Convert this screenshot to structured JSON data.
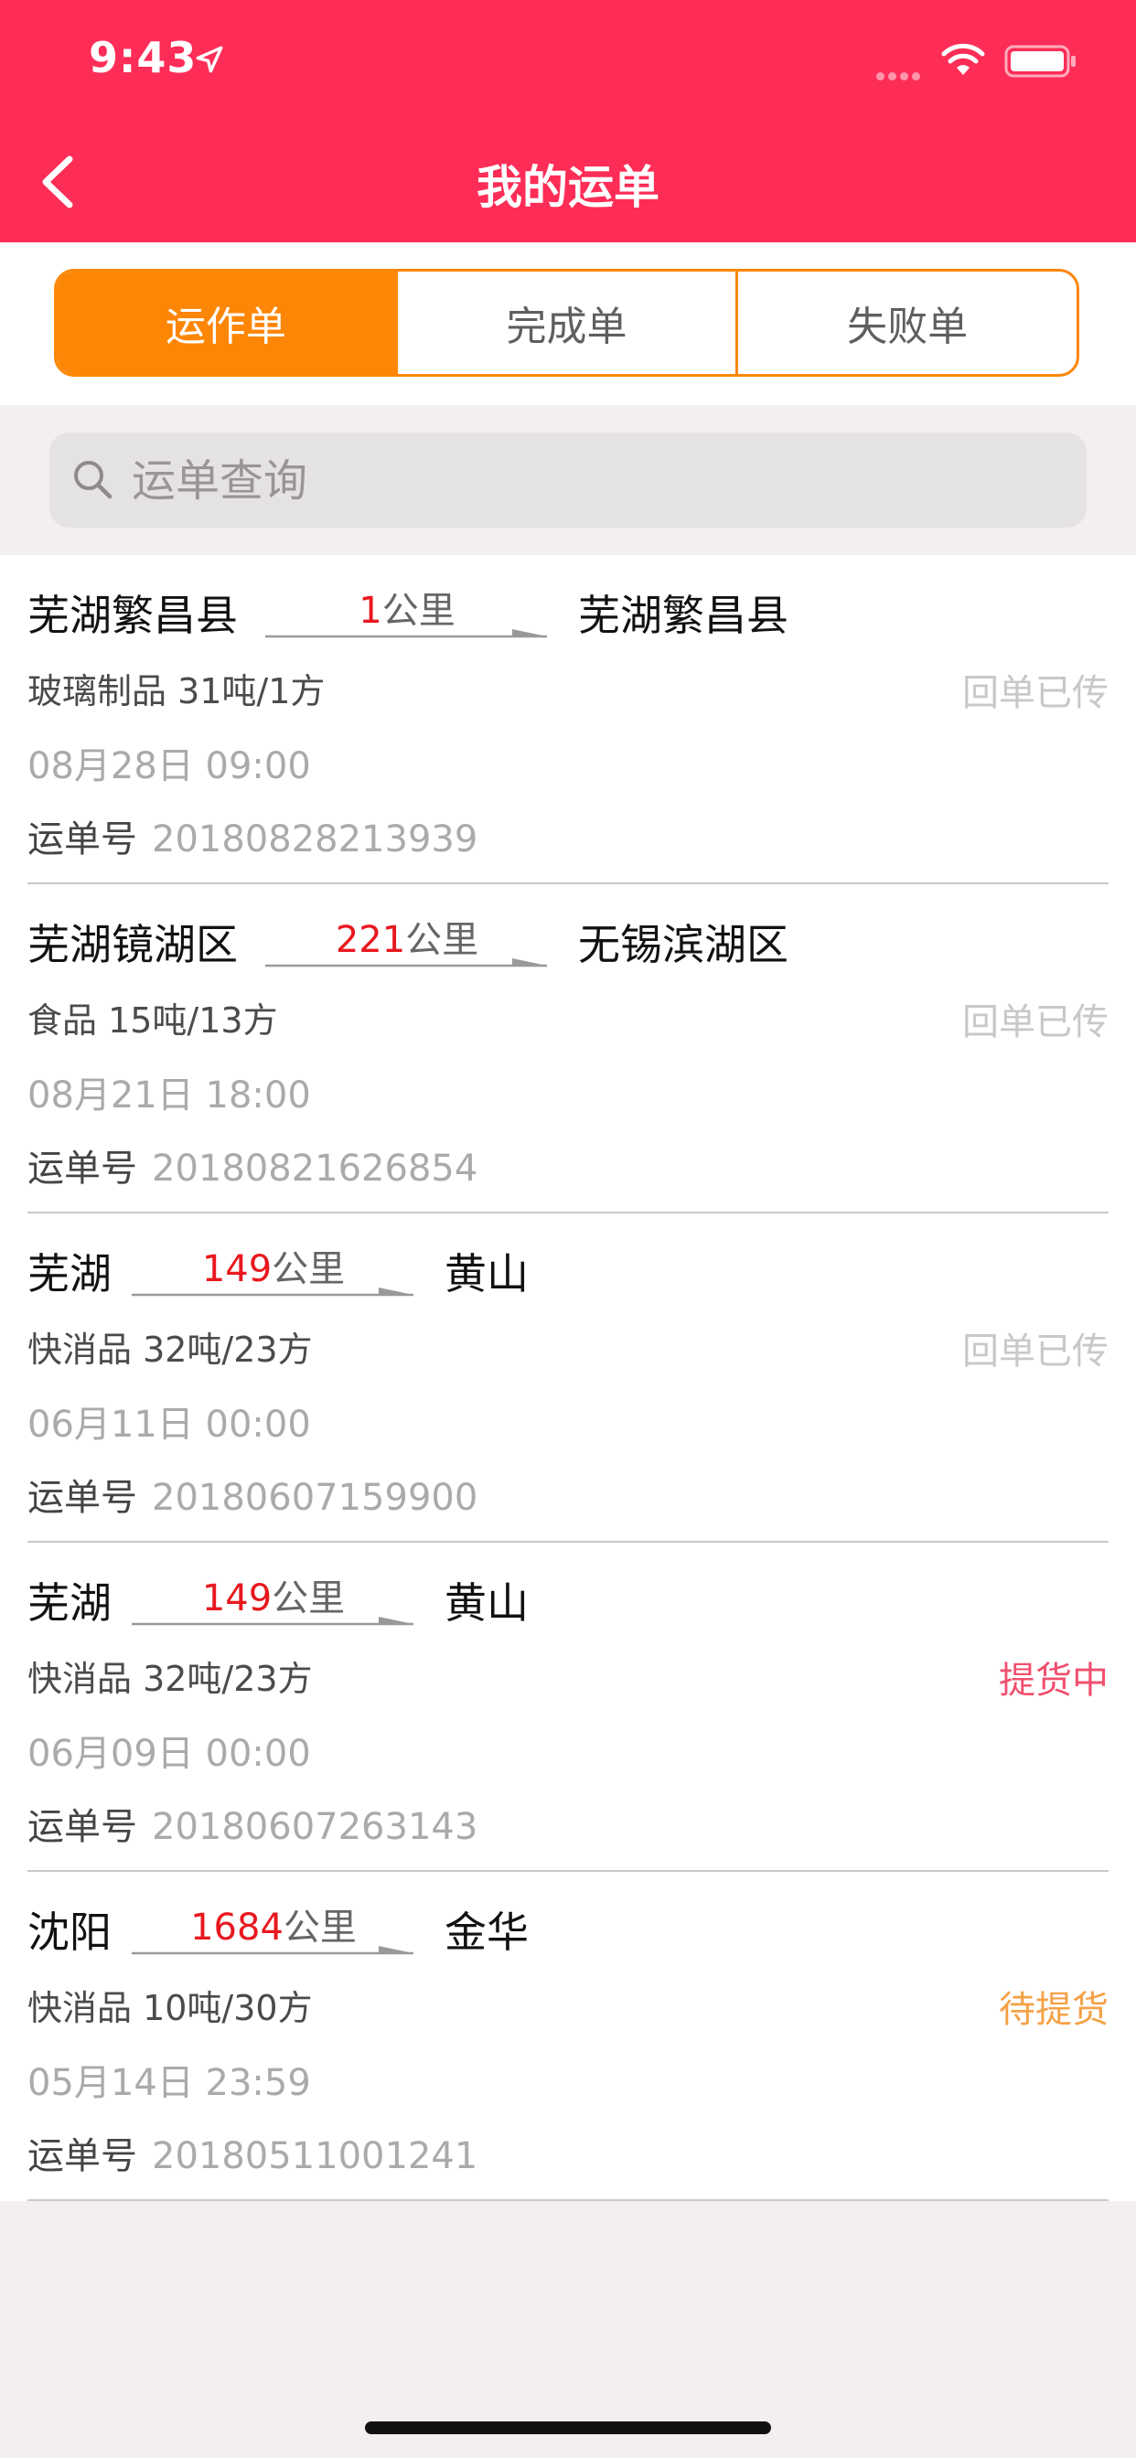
{
  "status_bar": {
    "time": "9:43"
  },
  "nav": {
    "title": "我的运单"
  },
  "tabs": [
    {
      "label": "运作单",
      "active": true
    },
    {
      "label": "完成单",
      "active": false
    },
    {
      "label": "失败单",
      "active": false
    }
  ],
  "search": {
    "placeholder": "运单查询"
  },
  "colors": {
    "brand_red": "#fd2d57",
    "accent_orange": "#fd8606",
    "distance_red": "#e8181f",
    "status_gray": "#c8c8c8",
    "status_pink": "#f0506e",
    "status_orange": "#f5a146"
  },
  "orders": [
    {
      "origin": "芜湖繁昌县",
      "distance_value": "1",
      "distance_unit": "公里",
      "destination": "芜湖繁昌县",
      "cargo": "玻璃制品 31吨/1方",
      "status": "回单已传",
      "status_color": "#c8c8c8",
      "date": "08月28日 09:00",
      "waybill_label": "运单号",
      "waybill_no": "20180828213939"
    },
    {
      "origin": "芜湖镜湖区",
      "distance_value": "221",
      "distance_unit": "公里",
      "destination": "无锡滨湖区",
      "cargo": "食品 15吨/13方",
      "status": "回单已传",
      "status_color": "#c8c8c8",
      "date": "08月21日 18:00",
      "waybill_label": "运单号",
      "waybill_no": "20180821626854"
    },
    {
      "origin": "芜湖",
      "distance_value": "149",
      "distance_unit": "公里",
      "destination": "黄山",
      "cargo": "快消品 32吨/23方",
      "status": "回单已传",
      "status_color": "#c8c8c8",
      "date": "06月11日 00:00",
      "waybill_label": "运单号",
      "waybill_no": "20180607159900"
    },
    {
      "origin": "芜湖",
      "distance_value": "149",
      "distance_unit": "公里",
      "destination": "黄山",
      "cargo": "快消品 32吨/23方",
      "status": "提货中",
      "status_color": "#f0506e",
      "date": "06月09日 00:00",
      "waybill_label": "运单号",
      "waybill_no": "20180607263143"
    },
    {
      "origin": "沈阳",
      "distance_value": "1684",
      "distance_unit": "公里",
      "destination": "金华",
      "cargo": "快消品 10吨/30方",
      "status": "待提货",
      "status_color": "#f5a146",
      "date": "05月14日 23:59",
      "waybill_label": "运单号",
      "waybill_no": "20180511001241"
    }
  ]
}
